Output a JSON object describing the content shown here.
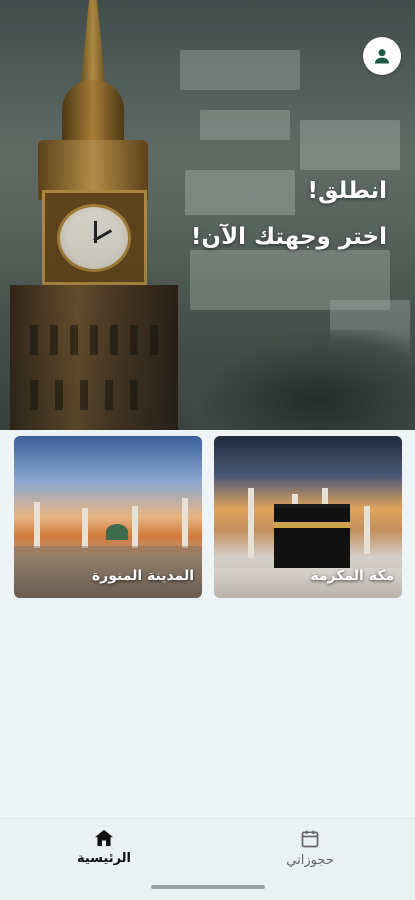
{
  "header": {
    "title": "انطلق!",
    "subtitle": "اختر وجهتك الآن!",
    "profile_icon": "person-icon"
  },
  "destinations": [
    {
      "label": "مكة المكرمة"
    },
    {
      "label": "المدينة المنورة"
    }
  ],
  "bottom_nav": {
    "items": [
      {
        "label": "الرئيسية",
        "icon": "home-icon",
        "active": true
      },
      {
        "label": "حجوزاتي",
        "icon": "calendar-icon",
        "active": false
      }
    ]
  },
  "colors": {
    "accent": "#1d5a44",
    "background": "#eef3f5",
    "nav_active": "#111111",
    "nav_inactive": "#666666"
  }
}
